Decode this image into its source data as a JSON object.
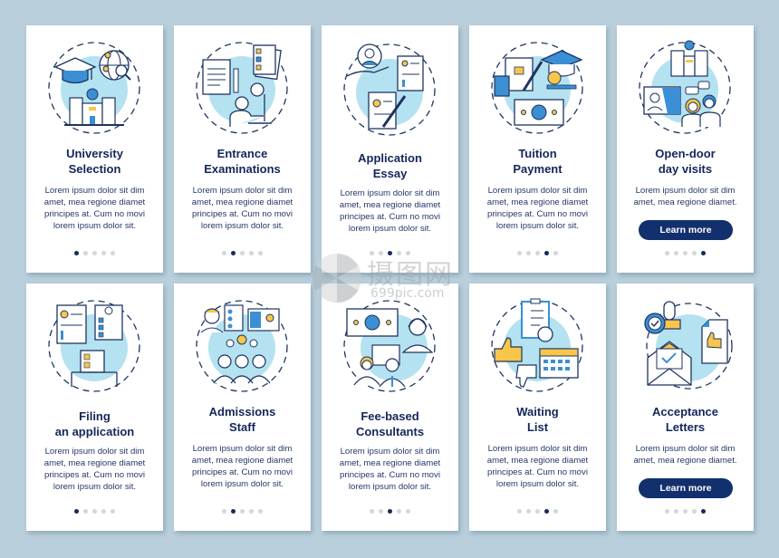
{
  "colors": {
    "background": "#b9cfdc",
    "card": "#ffffff",
    "title": "#14265a",
    "body_text": "#253767",
    "accent_circle": "#b4e2f1",
    "icon_stroke": "#1e3561",
    "icon_blue": "#3b8fd4",
    "icon_yellow": "#f7c64b",
    "button": "#13306e",
    "dot_active": "#17295c",
    "dot_inactive": "#d3d7dc"
  },
  "watermark": {
    "brand": "摄图网",
    "url": "699pic.com"
  },
  "rows": [
    {
      "cards": [
        {
          "icon": "university-selection-icon",
          "title": "University\nSelection",
          "body": "Lorem ipsum dolor sit dim\namet, mea regione diamet\nprincipes at. Cum no movi\nlorem ipsum dolor sit.",
          "active_dot": 0,
          "button": null
        },
        {
          "icon": "entrance-examinations-icon",
          "title": "Entrance\nExaminations",
          "body": "Lorem ipsum dolor sit dim\namet, mea regione diamet\nprincipes at. Cum no movi\nlorem ipsum dolor sit.",
          "active_dot": 1,
          "button": null
        },
        {
          "icon": "application-essay-icon",
          "title": "Application\nEssay",
          "body": "Lorem ipsum dolor sit dim\namet, mea regione diamet\nprincipes at. Cum no movi\nlorem ipsum dolor sit.",
          "active_dot": 2,
          "button": null
        },
        {
          "icon": "tuition-payment-icon",
          "title": "Tuition\nPayment",
          "body": "Lorem ipsum dolor sit dim\namet, mea regione diamet\nprincipes at. Cum no movi\nlorem ipsum dolor sit.",
          "active_dot": 3,
          "button": null
        },
        {
          "icon": "open-door-day-visits-icon",
          "title": "Open-door\nday visits",
          "body": "Lorem ipsum dolor sit dim\namet, mea regione diamet.",
          "active_dot": 4,
          "button": "Learn more"
        }
      ]
    },
    {
      "cards": [
        {
          "icon": "filing-application-icon",
          "title": "Filing\nan application",
          "body": "Lorem ipsum dolor sit dim\namet, mea regione diamet\nprincipes at. Cum no movi\nlorem ipsum dolor sit.",
          "active_dot": 0,
          "button": null
        },
        {
          "icon": "admissions-staff-icon",
          "title": "Admissions\nStaff",
          "body": "Lorem ipsum dolor sit dim\namet, mea regione diamet\nprincipes at. Cum no movi\nlorem ipsum dolor sit.",
          "active_dot": 1,
          "button": null
        },
        {
          "icon": "fee-based-consultants-icon",
          "title": "Fee-based\nConsultants",
          "body": "Lorem ipsum dolor sit dim\namet, mea regione diamet\nprincipes at. Cum no movi\nlorem ipsum dolor sit.",
          "active_dot": 2,
          "button": null
        },
        {
          "icon": "waiting-list-icon",
          "title": "Waiting\nList",
          "body": "Lorem ipsum dolor sit dim\namet, mea regione diamet\nprincipes at. Cum no movi\nlorem ipsum dolor sit.",
          "active_dot": 3,
          "button": null
        },
        {
          "icon": "acceptance-letters-icon",
          "title": "Acceptance\nLetters",
          "body": "Lorem ipsum dolor sit dim\namet, mea regione diamet.",
          "active_dot": 4,
          "button": "Learn more"
        }
      ]
    }
  ],
  "dots_per_screen": 5
}
